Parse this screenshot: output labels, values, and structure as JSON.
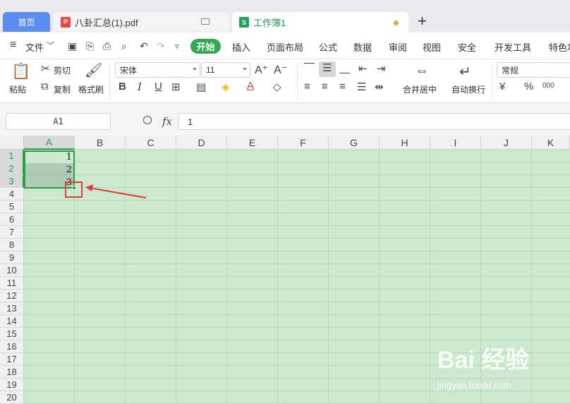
{
  "tabs": {
    "home": "首页",
    "pdf": "八卦汇总(1).pdf",
    "workbook": "工作簿1",
    "new_tab": "+"
  },
  "menu": {
    "file": "文件",
    "start": "开始",
    "items": [
      "插入",
      "页面布局",
      "公式",
      "数据",
      "审阅",
      "视图",
      "安全",
      "开发工具",
      "特色功"
    ]
  },
  "ribbon": {
    "paste": "粘贴",
    "cut": "剪切",
    "copy": "复制",
    "format_painter": "格式刷",
    "font_name": "宋体",
    "font_size": "11",
    "merge_center": "合并居中",
    "wrap_text": "自动换行",
    "number_format": "常规",
    "percent": "%",
    "thousands": "000"
  },
  "formula_bar": {
    "name_box": "A1",
    "fx_label": "fx",
    "formula_value": "1"
  },
  "grid": {
    "columns": [
      "A",
      "B",
      "C",
      "D",
      "E",
      "F",
      "G",
      "H",
      "I",
      "J",
      "K"
    ],
    "rows": [
      "1",
      "2",
      "3",
      "4",
      "5",
      "6",
      "7",
      "8",
      "9",
      "10",
      "11",
      "12",
      "13",
      "14",
      "15",
      "16",
      "17",
      "18",
      "19",
      "20"
    ],
    "cells": {
      "A1": "1",
      "A2": "2",
      "A3": "3"
    },
    "selection": "A1:A3"
  },
  "watermark": {
    "brand": "Bai 经验",
    "url": "jingyan.baidu.com"
  },
  "colors": {
    "accent_green": "#2a9d4f",
    "sheet_background": "#cce8cf",
    "home_tab": "#5b8df0",
    "highlight_red": "#e23b3b"
  }
}
